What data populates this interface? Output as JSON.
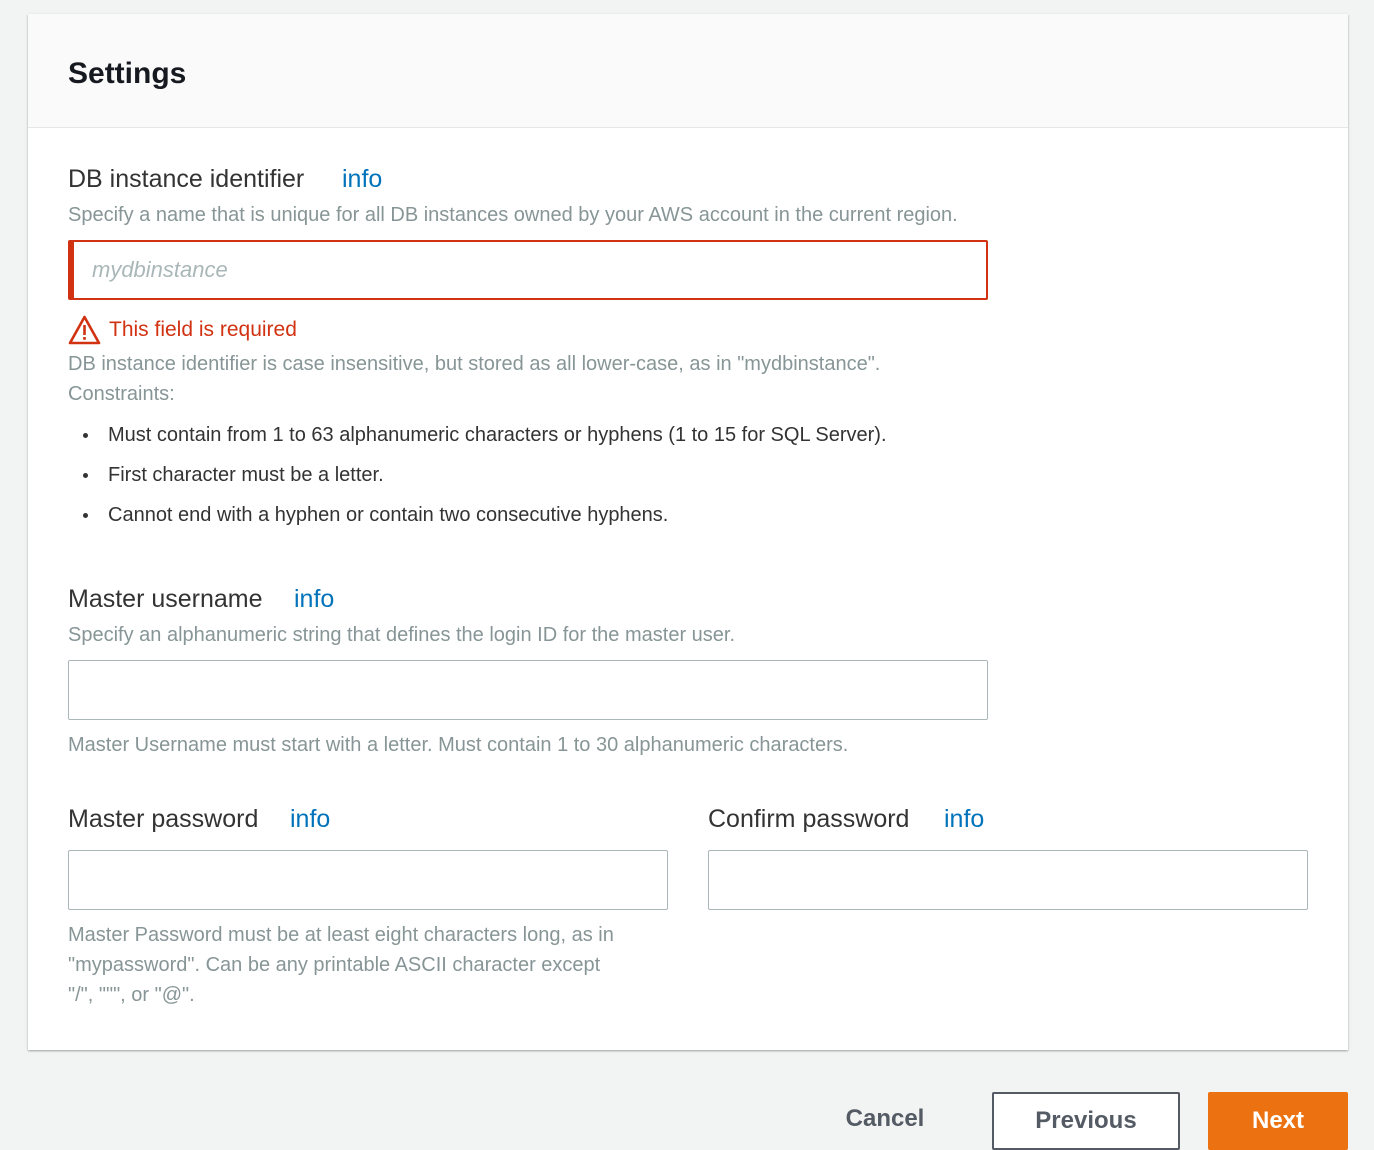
{
  "panel": {
    "title": "Settings"
  },
  "db_identifier": {
    "label": "DB instance identifier",
    "info": "info",
    "description": "Specify a name that is unique for all DB instances owned by your AWS account in the current region.",
    "placeholder": "mydbinstance",
    "value": "",
    "error": "This field is required",
    "help_line1": "DB instance identifier is case insensitive, but stored as all lower-case, as in \"mydbinstance\".",
    "help_line2": "Constraints:",
    "constraints": [
      "Must contain from 1 to 63 alphanumeric characters or hyphens (1 to 15 for SQL Server).",
      "First character must be a letter.",
      "Cannot end with a hyphen or contain two consecutive hyphens."
    ]
  },
  "master_username": {
    "label": "Master username",
    "info": "info",
    "description": "Specify an alphanumeric string that defines the login ID for the master user.",
    "value": "",
    "help": "Master Username must start with a letter. Must contain 1 to 30 alphanumeric characters."
  },
  "master_password": {
    "label": "Master password",
    "info": "info",
    "value": "",
    "help_line1": "Master Password must be at least eight characters long, as in",
    "help_line2": "\"mypassword\". Can be any printable ASCII character except",
    "help_line3": "\"/\", \"\"\", or \"@\"."
  },
  "confirm_password": {
    "label": "Confirm password",
    "info": "info",
    "value": ""
  },
  "footer": {
    "cancel_label": "Cancel",
    "previous_label": "Previous",
    "next_label": "Next"
  },
  "colors": {
    "accent": "#ec7211",
    "link": "#0073bb",
    "error": "#d13212"
  },
  "icons": {
    "error_icon": "warning-triangle-icon"
  }
}
